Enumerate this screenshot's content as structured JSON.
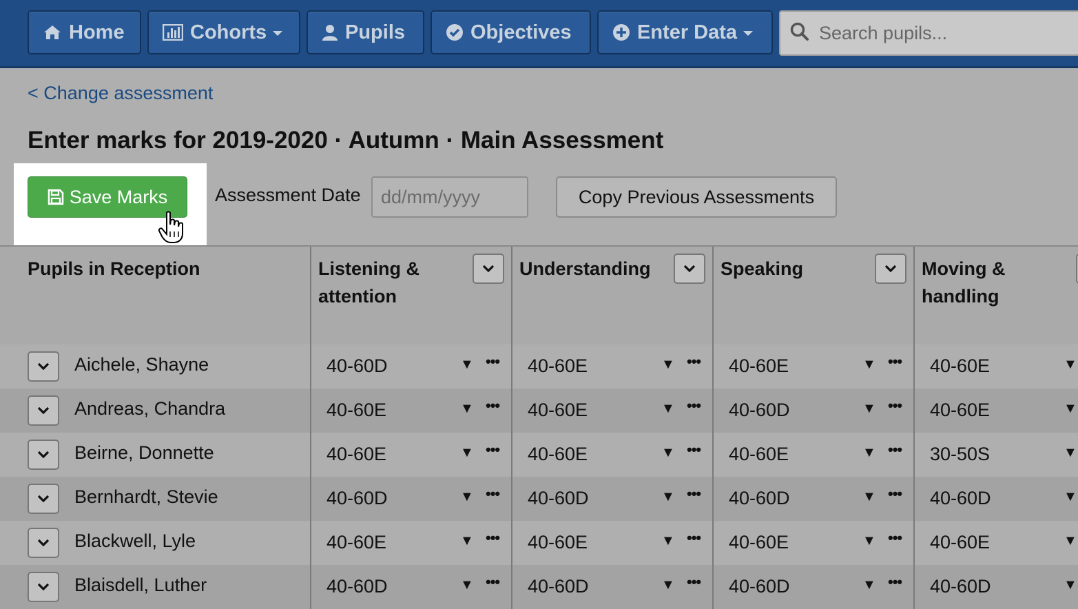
{
  "nav": {
    "home": "Home",
    "cohorts": "Cohorts",
    "pupils": "Pupils",
    "objectives": "Objectives",
    "enter_data": "Enter Data",
    "search_placeholder": "Search pupils..."
  },
  "back_link": "< Change assessment",
  "page_title": "Enter marks for 2019-2020 · Autumn · Main Assessment",
  "toolbar": {
    "save_label": "Save Marks",
    "date_label": "Assessment Date",
    "date_placeholder": "dd/mm/yyyy",
    "copy_label": "Copy Previous Assessments"
  },
  "table": {
    "pupil_header": "Pupils in Reception",
    "columns": [
      {
        "line1": "Listening &",
        "line2": "attention"
      },
      {
        "line1": "Understanding",
        "line2": ""
      },
      {
        "line1": "Speaking",
        "line2": ""
      },
      {
        "line1": "Moving &",
        "line2": "handling"
      }
    ],
    "rows": [
      {
        "name": "Aichele, Shayne",
        "marks": [
          "40-60D",
          "40-60E",
          "40-60E",
          "40-60E"
        ]
      },
      {
        "name": "Andreas, Chandra",
        "marks": [
          "40-60E",
          "40-60E",
          "40-60D",
          "40-60E"
        ]
      },
      {
        "name": "Beirne, Donnette",
        "marks": [
          "40-60E",
          "40-60E",
          "40-60E",
          "30-50S"
        ]
      },
      {
        "name": "Bernhardt, Stevie",
        "marks": [
          "40-60D",
          "40-60D",
          "40-60D",
          "40-60D"
        ]
      },
      {
        "name": "Blackwell, Lyle",
        "marks": [
          "40-60E",
          "40-60E",
          "40-60E",
          "40-60E"
        ]
      },
      {
        "name": "Blaisdell, Luther",
        "marks": [
          "40-60D",
          "40-60D",
          "40-60D",
          "40-60D"
        ]
      }
    ]
  },
  "colors": {
    "nav_bg": "#1f4c85",
    "save_green": "#4caa4b",
    "link_blue": "#1b4a82"
  }
}
